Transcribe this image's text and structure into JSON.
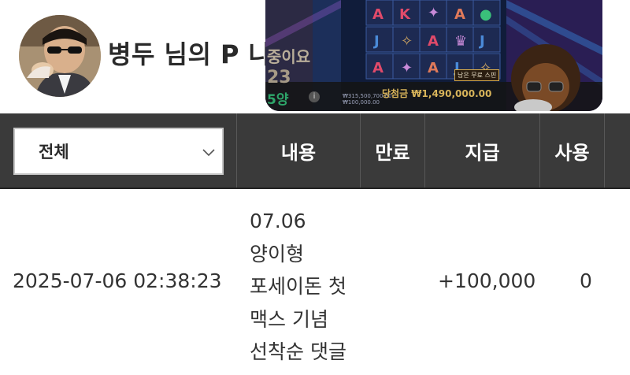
{
  "profile": {
    "name": "병두 님의 P 나",
    "avatar_icon": "user-avatar-photo"
  },
  "video_overlay": {
    "partial_text": "중이요",
    "partial_number": "23",
    "partial_green": "5양",
    "win_text": "당첨금 ₩1,490,000.00",
    "small_line1": "₩315,500,700.00",
    "small_line2": "₩100,000.00",
    "free_spin_label": "남은 무료 스핀"
  },
  "table": {
    "filter": {
      "selected": "전체",
      "icon": "chevron-down-icon"
    },
    "columns": {
      "content": "내용",
      "expire": "만료",
      "pay": "지급",
      "use": "사용"
    },
    "rows": [
      {
        "date": "2025-07-06 02:38:23",
        "content": "07.06 양이형 포세이돈 첫 맥스 기념 선착순 댓글",
        "expire": "",
        "pay": "+100,000",
        "use": "0"
      }
    ]
  },
  "colors": {
    "header_bg": "#3a3a3a",
    "header_text": "#ffffff",
    "body_text": "#333333"
  }
}
